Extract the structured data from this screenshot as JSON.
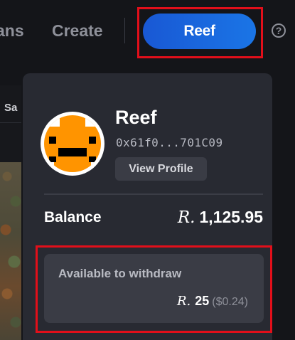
{
  "header": {
    "nav_partial": "ans",
    "nav_create": "Create",
    "account_button_label": "Reef",
    "help_icon": "question-circle-icon",
    "help_glyph": "?"
  },
  "side": {
    "tab_partial": "Sa"
  },
  "account": {
    "name": "Reef",
    "address": "0x61f0...701C09",
    "view_profile_label": "View Profile",
    "avatar_icon": "pixel-avatar-icon",
    "avatar_color": "#ff9400"
  },
  "balance": {
    "label": "Balance",
    "currency_symbol": "R.",
    "value": "1,125.95"
  },
  "withdraw": {
    "label": "Available to withdraw",
    "currency_symbol": "R.",
    "amount": "25",
    "usd": "($0.24)"
  },
  "colors": {
    "accent": "#1a6bdf",
    "highlight": "#e20f1a",
    "panel": "#282a32",
    "background": "#141519"
  }
}
